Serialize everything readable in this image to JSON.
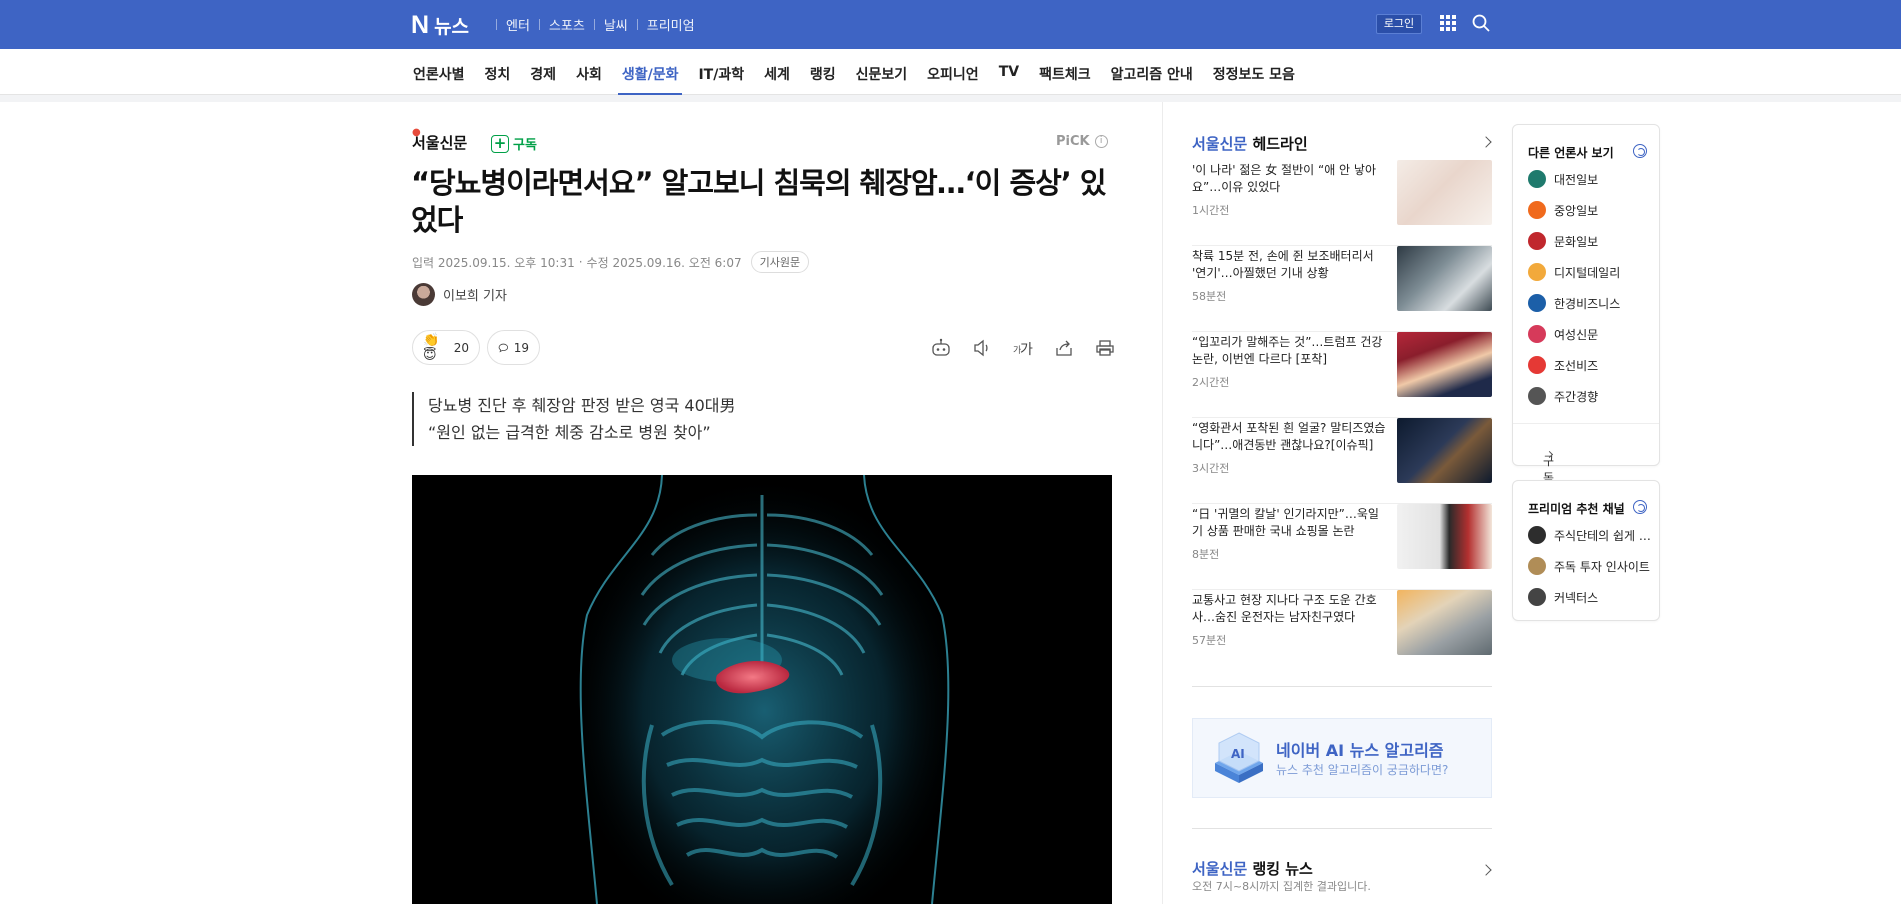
{
  "header": {
    "logo_n": "N",
    "logo_word": "뉴스",
    "nav": [
      "엔터",
      "스포츠",
      "날씨",
      "프리미엄"
    ],
    "login_label": "로그인"
  },
  "categories": [
    {
      "label": "언론사별"
    },
    {
      "label": "정치"
    },
    {
      "label": "경제"
    },
    {
      "label": "사회"
    },
    {
      "label": "생활/문화",
      "active": true
    },
    {
      "label": "IT/과학"
    },
    {
      "label": "세계"
    },
    {
      "label": "랭킹"
    },
    {
      "label": "신문보기"
    },
    {
      "label": "오피니언"
    },
    {
      "label": "TV"
    },
    {
      "label": "팩트체크"
    },
    {
      "label": "알고리즘 안내"
    },
    {
      "label": "정정보도 모음"
    }
  ],
  "article": {
    "press": "서울신문",
    "subscribe_label": "구독",
    "pick_label": "PiCK",
    "title": "“당뇨병이라면서요” 알고보니 침묵의 췌장암…‘이 증상’ 있었다",
    "input_date": "입력 2025.09.15. 오후 10:31",
    "modified_date": "수정 2025.09.16. 오전 6:07",
    "original_label": "기사원문",
    "author": "이보희 기자",
    "reactions": {
      "count": "20",
      "comments": "19"
    },
    "summary": [
      "당뇨병 진단 후 췌장암 판정 받은 영국 40대男",
      "“원인 없는 급격한 체중 감소로 병원 찾아”"
    ]
  },
  "headlines": {
    "press": "서울신문",
    "suffix": "헤드라인",
    "items": [
      {
        "title": "'이 나라' 젊은 女 절반이 “애 안 낳아요”…이유 있었다",
        "time": "1시간전"
      },
      {
        "title": "착륙 15분 전, 손에 쥔 보조배터리서 '연기'…아찔했던 기내 상황",
        "time": "58분전"
      },
      {
        "title": "“입꼬리가 말해주는 것”…트럼프 건강 논란, 이번엔 다르다 [포착]",
        "time": "2시간전"
      },
      {
        "title": "“영화관서 포착된 흰 얼굴? 말티즈였습니다”…애견동반 괜찮나요?[이슈픽]",
        "time": "3시간전"
      },
      {
        "title": "“日 '귀멸의 칼날' 인기라지만”…욱일기 상품 판매한 국내 쇼핑몰 논란",
        "time": "8분전"
      },
      {
        "title": "교통사고 현장 지나다 구조 도운 간호사…숨진 운전자는 남자친구였다",
        "time": "57분전"
      }
    ]
  },
  "ai_banner": {
    "title": "네이버 AI 뉴스 알고리즘",
    "subtitle": "뉴스 추천 알고리즘이 궁금하다면?"
  },
  "ranking": {
    "press": "서울신문",
    "suffix": "랭킹 뉴스",
    "subtitle": "오전 7시~8시까지 집계한 결과입니다."
  },
  "other_press": {
    "title": "다른 언론사 보기",
    "items": [
      {
        "label": "대전일보",
        "color": "#1f7a6d"
      },
      {
        "label": "중앙일보",
        "color": "#f06a1d"
      },
      {
        "label": "문화일보",
        "color": "#c0272d"
      },
      {
        "label": "디지털데일리",
        "color": "#f2a93b"
      },
      {
        "label": "한경비즈니스",
        "color": "#1c5fa8"
      },
      {
        "label": "여성신문",
        "color": "#d63a5a"
      },
      {
        "label": "조선비즈",
        "color": "#e53935"
      },
      {
        "label": "주간경향",
        "color": "#555555"
      }
    ],
    "footer": "구독 설정"
  },
  "premium": {
    "title": "프리미엄 추천 채널",
    "items": [
      {
        "label": "주식단테의 쉽게 배우는 주식",
        "color": "#2d2d2d"
      },
      {
        "label": "주독 투자 인사이트",
        "color": "#b08d57"
      },
      {
        "label": "커넥터스",
        "color": "#444444"
      }
    ]
  },
  "colors": {
    "brand": "#3e64c4",
    "subscribe_green": "#00a047"
  }
}
